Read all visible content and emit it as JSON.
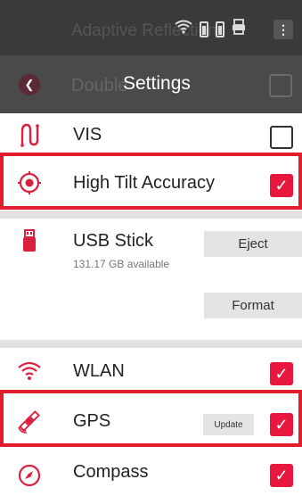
{
  "status_bar": {
    "background_text": "Adaptive Reflection",
    "icons": [
      "wifi-icon",
      "battery-icon",
      "battery-icon",
      "printer-icon",
      "kebab-menu-icon"
    ]
  },
  "app_bar": {
    "title": "Settings",
    "background_text": "Double",
    "back_icon": "chevron-left-icon"
  },
  "items": {
    "vis": {
      "label": "VIS",
      "icon": "vis-sensor-icon",
      "checked": false
    },
    "high_tilt": {
      "label": "High Tilt Accuracy",
      "icon": "tilt-target-icon",
      "checked": true,
      "highlighted": true
    },
    "usb": {
      "label": "USB Stick",
      "sub": "131.17 GB available",
      "icon": "usb-stick-icon",
      "eject": "Eject",
      "format": "Format"
    },
    "wlan": {
      "label": "WLAN",
      "icon": "wifi-icon",
      "checked": true
    },
    "gps": {
      "label": "GPS",
      "icon": "satellite-icon",
      "update": "Update",
      "checked": true,
      "highlighted": true
    },
    "compass": {
      "label": "Compass",
      "icon": "compass-icon",
      "checked": true
    }
  },
  "colors": {
    "accent": "#e8173f",
    "highlight": "#e21d2c",
    "header": "#4a4a4a"
  },
  "check_glyph": "✓"
}
